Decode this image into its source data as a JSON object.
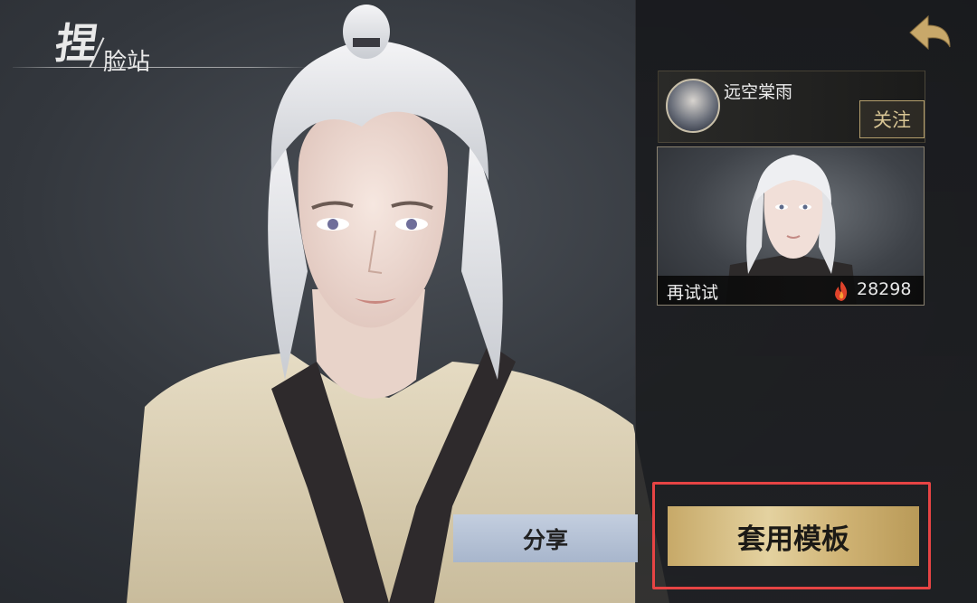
{
  "header": {
    "title_main": "捏",
    "title_sub": "脸站"
  },
  "author": {
    "name": "远空棠雨",
    "follow_label": "关注"
  },
  "template": {
    "retry_label": "再试试",
    "popularity": "28298"
  },
  "actions": {
    "share_label": "分享",
    "apply_label": "套用模板"
  },
  "colors": {
    "accent_gold": "#d9c089",
    "share_button": "#b6c2d6",
    "highlight_box": "#e64444"
  },
  "icons": [
    "back-arrow-icon",
    "fire-icon"
  ]
}
